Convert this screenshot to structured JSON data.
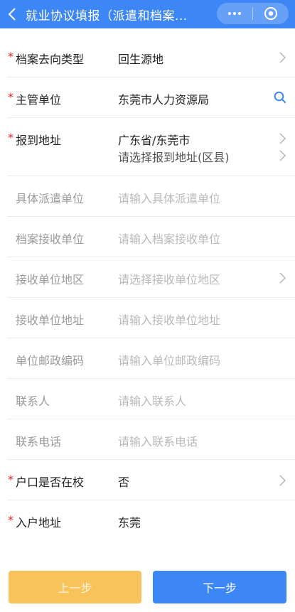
{
  "header": {
    "title": "就业协议填报（派遣和档案..."
  },
  "form": {
    "rows": [
      {
        "label": "档案去向类型",
        "required": true,
        "value": "回生源地",
        "placeholder": false,
        "icon": "chevron-right-icon"
      },
      {
        "label": "主管单位",
        "required": true,
        "value": "东莞市人力资源局",
        "placeholder": false,
        "icon": "search-icon"
      },
      {
        "label": "报到地址",
        "required": true,
        "value": "广东省/东莞市",
        "value2": "请选择报到地址(区县)",
        "placeholder": false,
        "icon": "chevron-right-icon"
      },
      {
        "label": "具体派遣单位",
        "required": false,
        "value": "请输入具体派遣单位",
        "placeholder": true
      },
      {
        "label": "档案接收单位",
        "required": false,
        "value": "请输入档案接收单位",
        "placeholder": true
      },
      {
        "label": "接收单位地区",
        "required": false,
        "value": "请选择接收单位地区",
        "placeholder": true,
        "icon": "chevron-right-icon"
      },
      {
        "label": "接收单位地址",
        "required": false,
        "value": "请输入接收单位地址",
        "placeholder": true
      },
      {
        "label": "单位邮政编码",
        "required": false,
        "value": "请输入单位邮政编码",
        "placeholder": true
      },
      {
        "label": "联系人",
        "required": false,
        "value": "请输入联系人",
        "placeholder": true
      },
      {
        "label": "联系电话",
        "required": false,
        "value": "请输入联系电话",
        "placeholder": true
      },
      {
        "label": "户口是否在校",
        "required": true,
        "value": "否",
        "placeholder": false,
        "icon": "chevron-right-icon"
      },
      {
        "label": "入户地址",
        "required": true,
        "value": "东莞",
        "placeholder": false
      }
    ],
    "required_mark": "*"
  },
  "buttons": {
    "prev_label": "上一步",
    "next_label": "下一步"
  },
  "colors": {
    "primary": "#3d86f5",
    "secondary": "#f8c35a",
    "required": "#e02020"
  }
}
